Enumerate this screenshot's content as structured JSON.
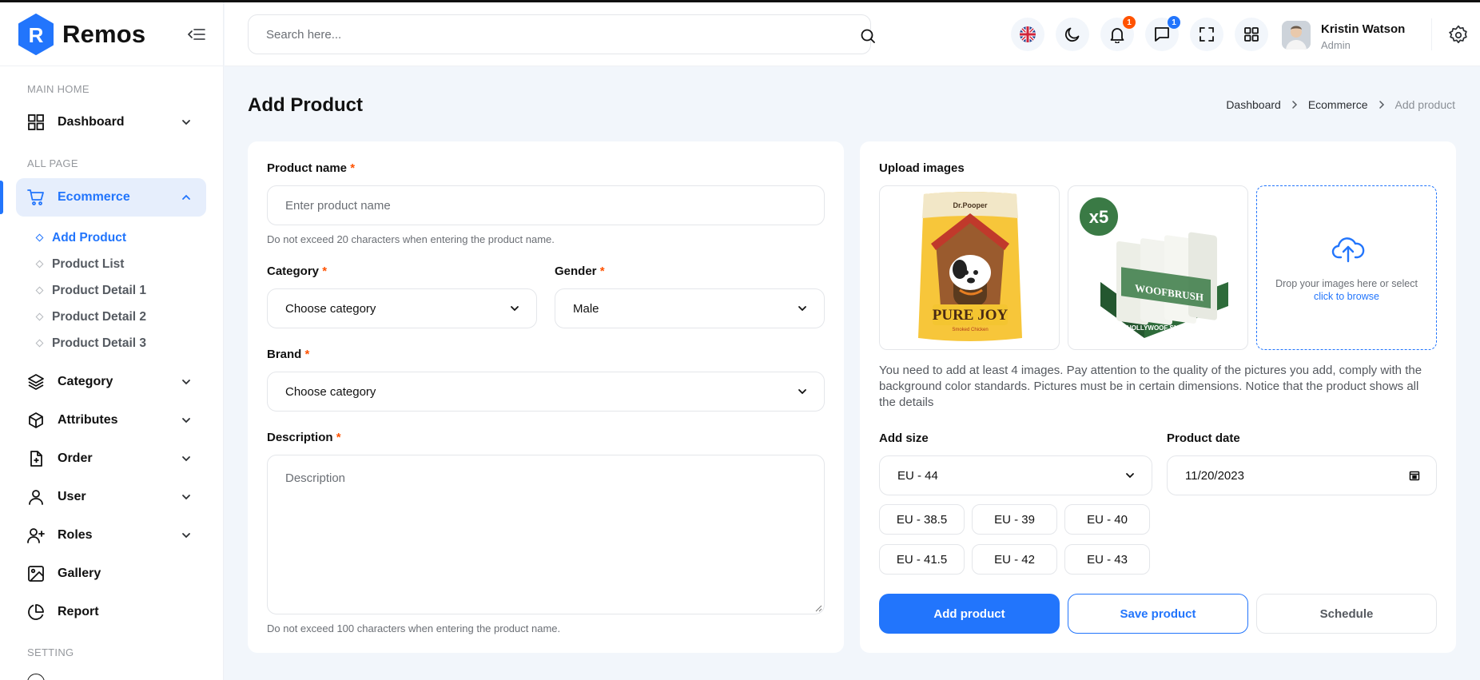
{
  "app": {
    "name": "Remos"
  },
  "sidebar": {
    "sections": {
      "main_home": "MAIN HOME",
      "all_page": "ALL PAGE",
      "setting": "SETTING"
    },
    "dashboard": "Dashboard",
    "ecommerce": "Ecommerce",
    "ecommerce_sub": [
      "Add Product",
      "Product List",
      "Product Detail 1",
      "Product Detail 2",
      "Product Detail 3"
    ],
    "items": [
      "Category",
      "Attributes",
      "Order",
      "User",
      "Roles",
      "Gallery",
      "Report"
    ],
    "active_sub": "Add Product"
  },
  "header": {
    "search_placeholder": "Search here...",
    "notifications_count": "1",
    "messages_count": "1",
    "user": {
      "name": "Kristin Watson",
      "role": "Admin"
    }
  },
  "page": {
    "title": "Add Product",
    "breadcrumb": [
      "Dashboard",
      "Ecommerce",
      "Add product"
    ]
  },
  "form": {
    "product_name": {
      "label": "Product name",
      "placeholder": "Enter product name",
      "hint": "Do not exceed 20 characters when entering the product name."
    },
    "category": {
      "label": "Category",
      "value": "Choose category"
    },
    "gender": {
      "label": "Gender",
      "value": "Male"
    },
    "brand": {
      "label": "Brand",
      "value": "Choose category"
    },
    "description": {
      "label": "Description",
      "placeholder": "Description",
      "hint": "Do not exceed 100 characters when entering the product name."
    }
  },
  "upload": {
    "label": "Upload images",
    "images": [
      {
        "alt": "Dr. Pooper Pure Joy treat bag",
        "brand_text": "Dr.Pooper",
        "product_text": "PURE JOY",
        "sub_text": "Smoked Chicken"
      },
      {
        "alt": "Woofbrush dental chews display box",
        "badge": "x5",
        "product_text": "WOOFBRUSH",
        "sub_text": "HOLLYWOOF SMILE"
      }
    ],
    "drop_text": "Drop your images here or select",
    "drop_link": "click to browse",
    "note": "You need to add at least 4 images. Pay attention to the quality of the pictures you add, comply with the background color standards. Pictures must be in certain dimensions. Notice that the product shows all the details"
  },
  "size": {
    "label": "Add size",
    "selected": "EU - 44",
    "options": [
      "EU - 38.5",
      "EU - 39",
      "EU - 40",
      "EU - 41.5",
      "EU - 42",
      "EU - 43"
    ]
  },
  "date": {
    "label": "Product date",
    "value": "11/20/2023"
  },
  "actions": {
    "add": "Add product",
    "save": "Save product",
    "schedule": "Schedule"
  },
  "colors": {
    "accent": "#2275fc",
    "required": "#ff5200",
    "badge_orange": "#ff5200",
    "badge_blue": "#2275fc",
    "background": "#f2f6fb"
  }
}
